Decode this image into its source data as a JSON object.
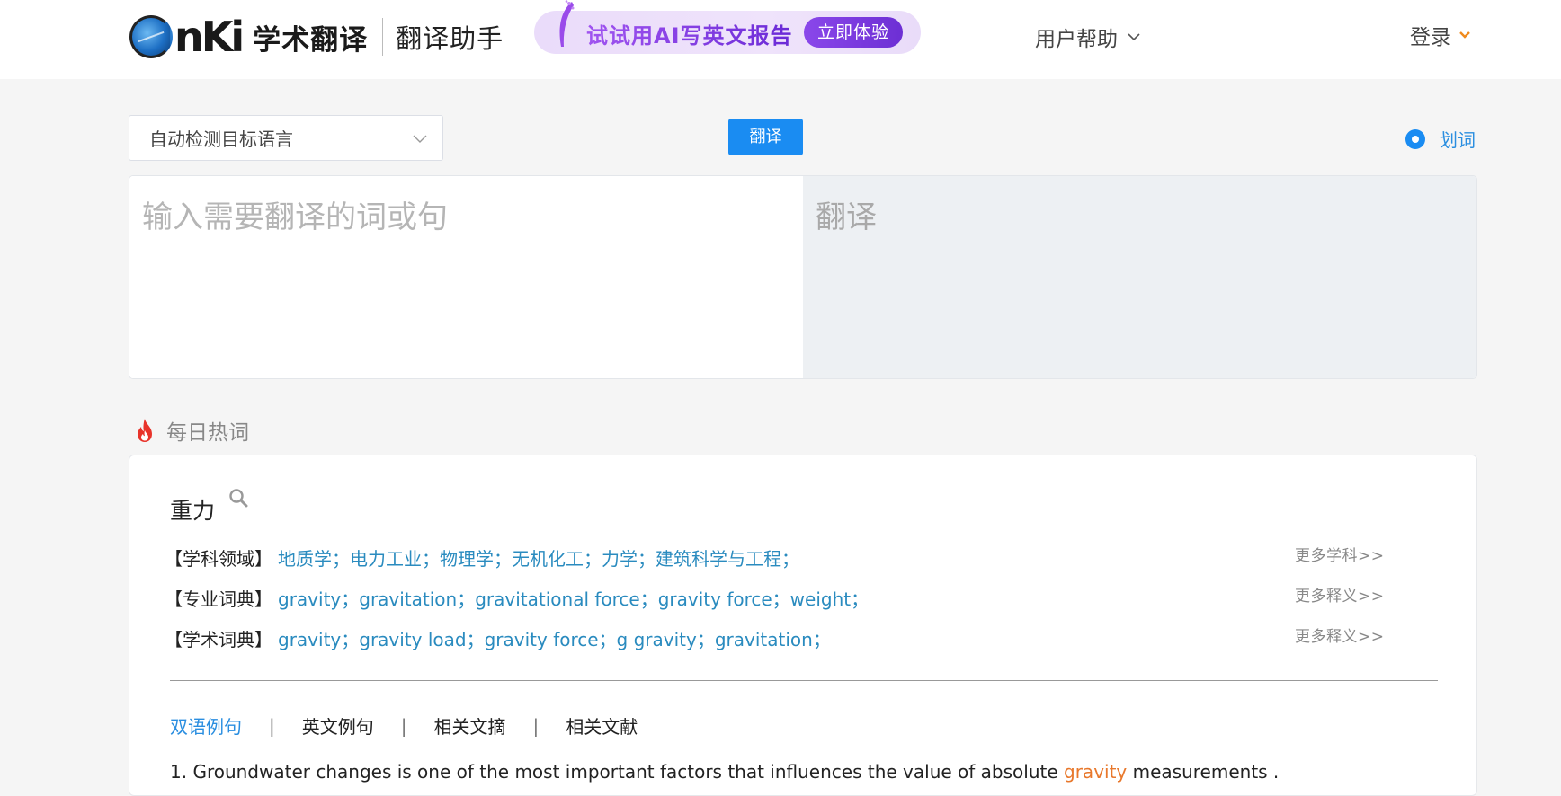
{
  "header": {
    "logo_text": "nKi",
    "brand_title": "学术翻译",
    "brand_subtitle": "翻译助手",
    "banner_text": "试试用AI写英文报告",
    "banner_button": "立即体验",
    "help_label": "用户帮助",
    "login_label": "登录"
  },
  "toolbar": {
    "language_selected": "自动检测目标语言",
    "translate_button": "翻译",
    "huaci_label": "划词"
  },
  "panels": {
    "input_placeholder": "输入需要翻译的词或句",
    "output_placeholder": "翻译"
  },
  "hot": {
    "title": "每日热词",
    "word": "重力",
    "rows": [
      {
        "label": "【学科领域】",
        "items": "地质学；电力工业；物理学；无机化工；力学；建筑科学与工程；",
        "more": "更多学科>>"
      },
      {
        "label": "【专业词典】",
        "items": "gravity；gravitation；gravitational force；gravity force；weight；",
        "more": "更多释义>>"
      },
      {
        "label": "【学术词典】",
        "items": "gravity；gravity load；gravity force；g gravity；gravitation；",
        "more": "更多释义>>"
      }
    ],
    "tabs": [
      "双语例句",
      "英文例句",
      "相关文摘",
      "相关文献"
    ],
    "tab_separator": "|",
    "sentence": {
      "prefix": "1. Groundwater changes is one of the most important factors that influences the value of absolute ",
      "highlight": "gravity",
      "suffix": " measurements ."
    }
  },
  "colors": {
    "primary": "#1a8cf2",
    "link": "#2a8bbf",
    "highlight": "#e8782c",
    "banner_purple": "#7a36de",
    "flame": "#e8332a"
  }
}
